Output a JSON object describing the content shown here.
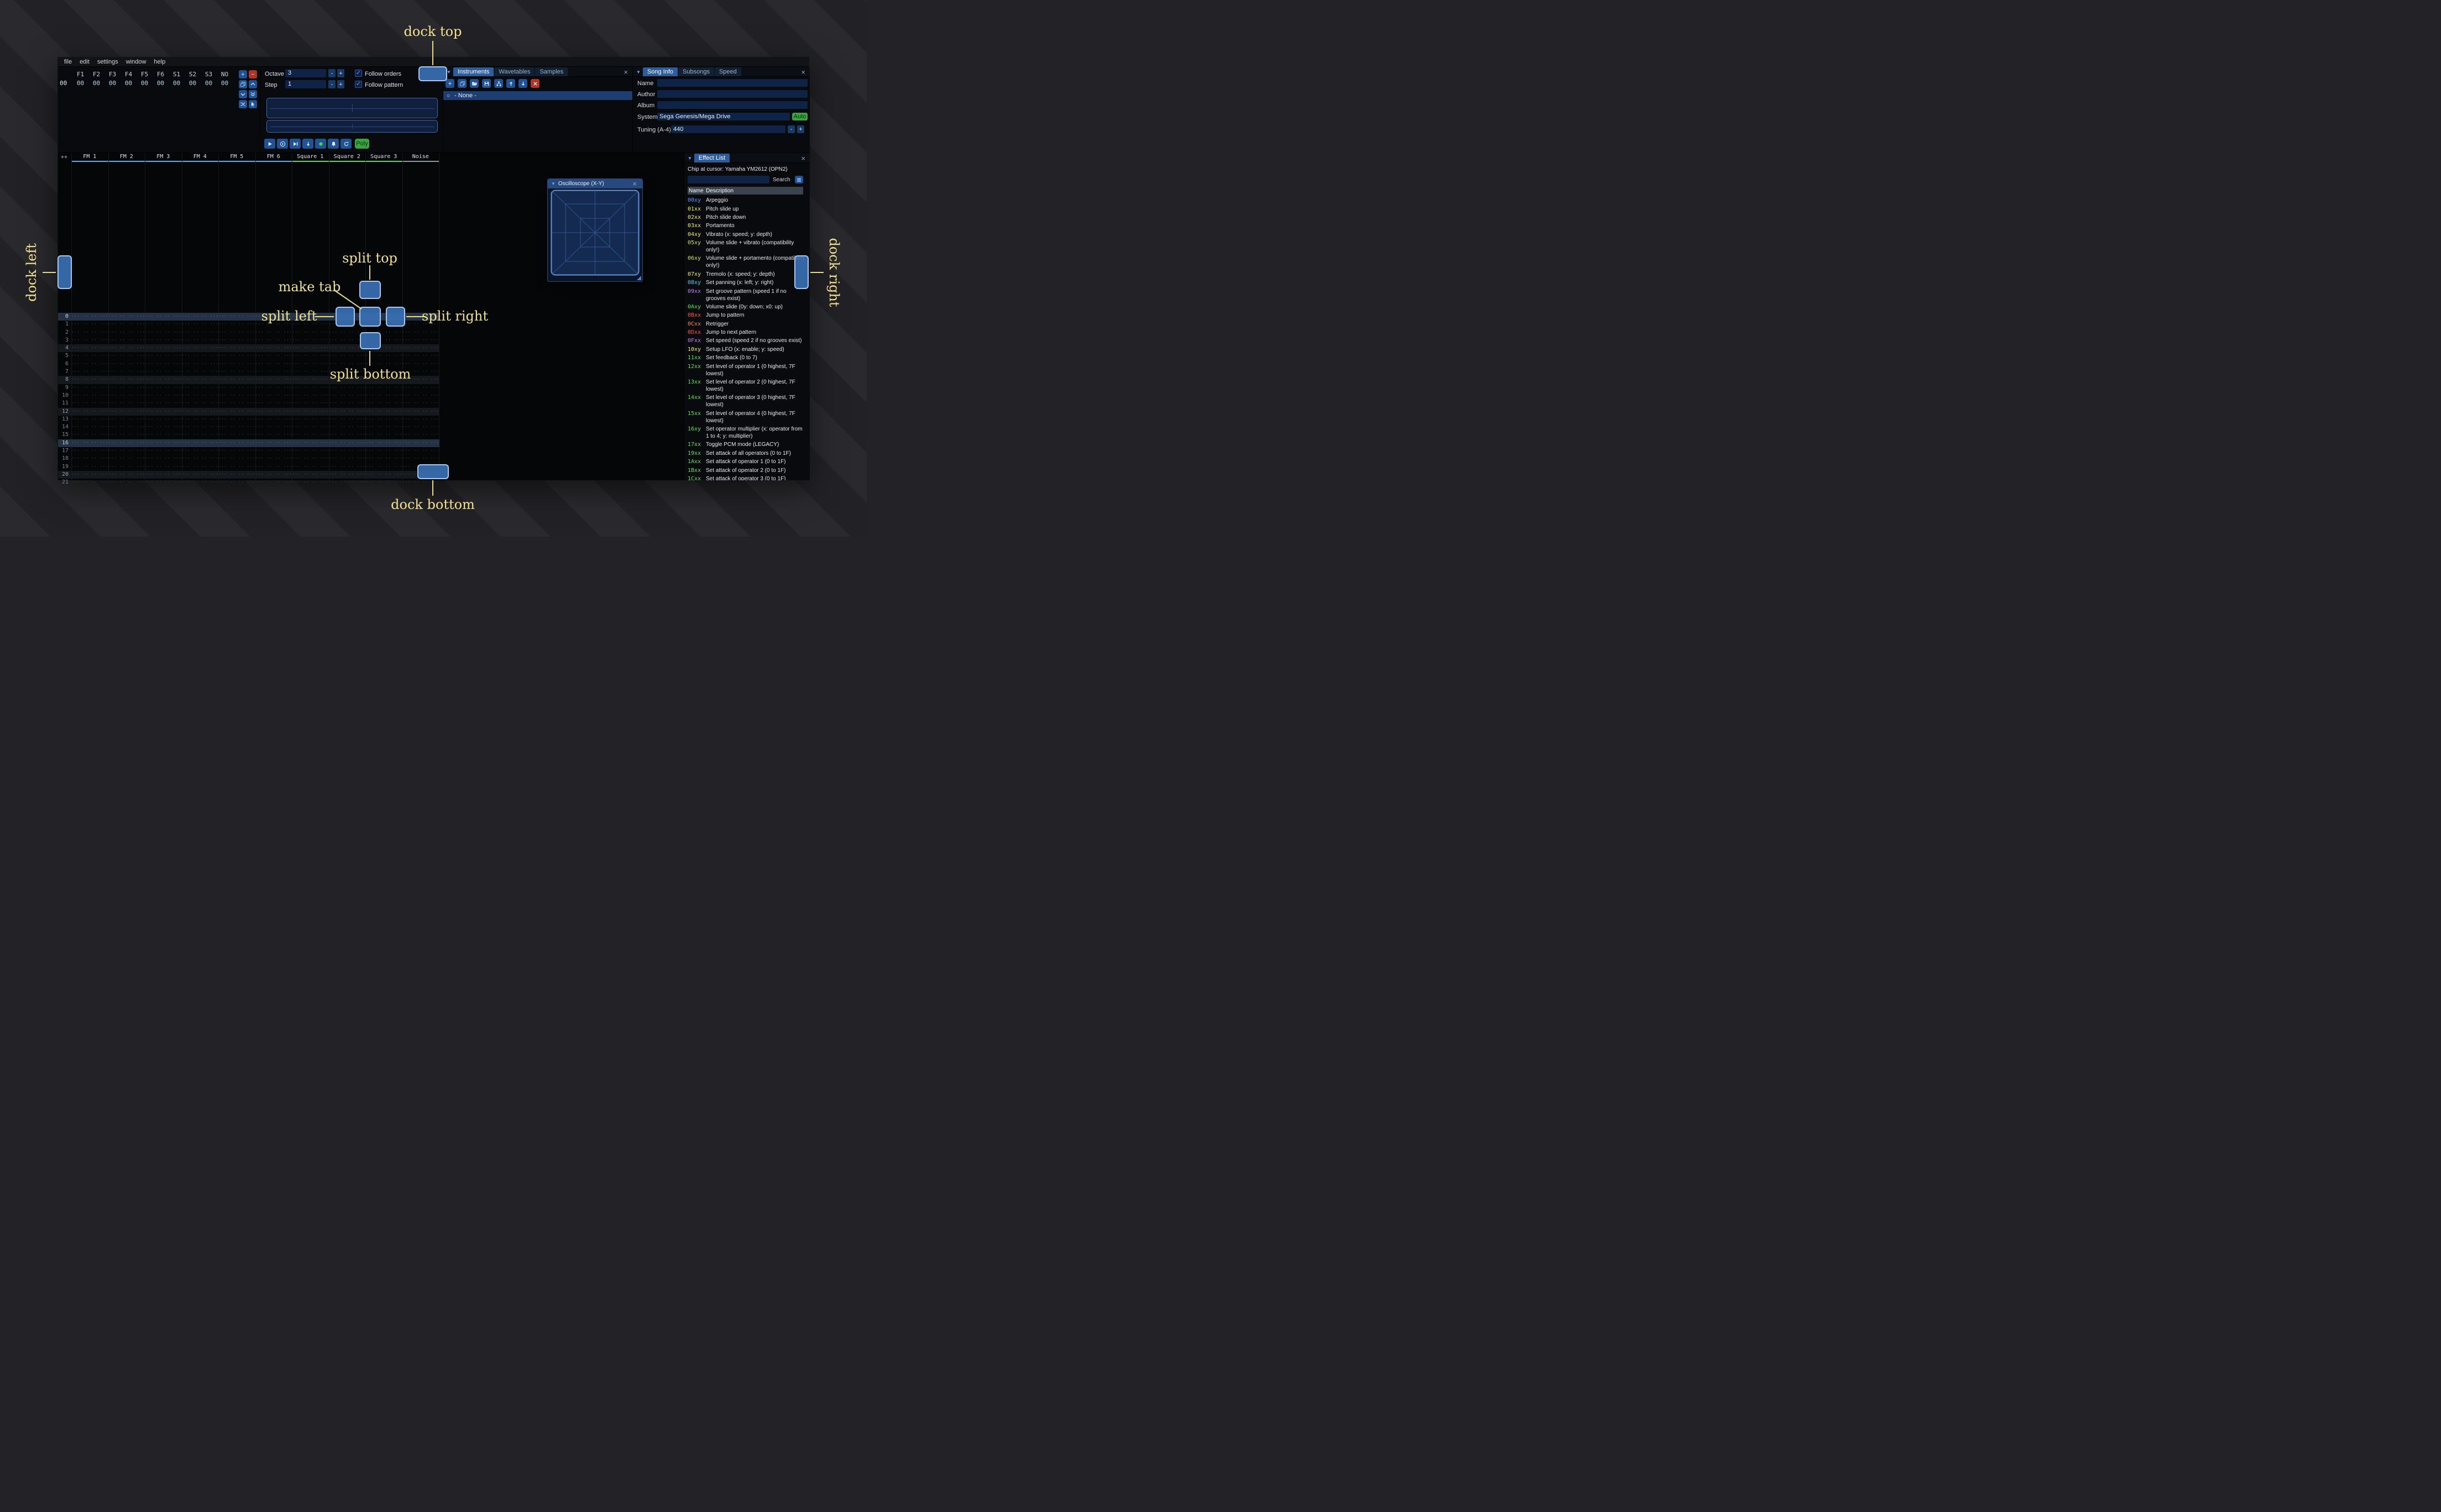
{
  "colors": {
    "accent": "#2d5d9d",
    "dock_fill": "#3a70b4",
    "annotation": "#f2e18f"
  },
  "icons": {
    "close": "×",
    "collapse": "▼",
    "radio": "○",
    "check": "✓",
    "minus": "-",
    "plus": "+"
  },
  "annotations": {
    "dock_top": "dock top",
    "dock_bottom": "dock bottom",
    "dock_left": "dock left",
    "dock_right": "dock right",
    "split_top": "split top",
    "split_bottom": "split bottom",
    "split_left": "split left",
    "split_right": "split right",
    "make_tab": "make tab"
  },
  "menu": {
    "items": [
      "file",
      "edit",
      "settings",
      "window",
      "help"
    ]
  },
  "orders": {
    "headers": [
      "F1",
      "F2",
      "F3",
      "F4",
      "F5",
      "F6",
      "S1",
      "S2",
      "S3",
      "NO"
    ],
    "row_label": "00",
    "row_values": [
      "00",
      "00",
      "00",
      "00",
      "00",
      "00",
      "00",
      "00",
      "00",
      "00"
    ],
    "buttons": [
      {
        "icon": "plus-sym",
        "name": "add-order"
      },
      {
        "icon": "minus-sym",
        "name": "remove-order",
        "red": true
      },
      {
        "icon": "duplicate",
        "name": "duplicate-order"
      },
      {
        "icon": "chevron-up",
        "name": "move-order-up"
      },
      {
        "icon": "chevron-down",
        "name": "move-order-down"
      },
      {
        "icon": "double-down",
        "name": "duplicate-order-to-end"
      },
      {
        "icon": "shuffle",
        "name": "order-change-mode"
      },
      {
        "icon": "pointer",
        "name": "order-edit-mode"
      }
    ]
  },
  "transport": {
    "octave_label": "Octave",
    "octave_value": "3",
    "step_label": "Step",
    "step_value": "1",
    "follow_orders_label": "Follow orders",
    "follow_pattern_label": "Follow pattern",
    "poly_label": "Poly",
    "buttons": [
      {
        "icon": "play",
        "name": "play"
      },
      {
        "icon": "play-circle",
        "name": "play-from-start"
      },
      {
        "icon": "play-once",
        "name": "play-pattern"
      },
      {
        "icon": "arrow-down",
        "name": "step-one-row"
      },
      {
        "icon": "record",
        "name": "record"
      },
      {
        "icon": "bell",
        "name": "metronome"
      },
      {
        "icon": "repeat",
        "name": "repeat-pattern"
      }
    ]
  },
  "instruments": {
    "tabs": [
      {
        "label": "Instruments",
        "active": true
      },
      {
        "label": "Wavetables",
        "active": false
      },
      {
        "label": "Samples",
        "active": false
      }
    ],
    "toolbar": [
      {
        "icon": "plus-sym",
        "name": "add-instrument"
      },
      {
        "icon": "duplicate",
        "name": "duplicate-instrument"
      },
      {
        "icon": "folder-open",
        "name": "open-instrument"
      },
      {
        "icon": "save",
        "name": "save-instrument"
      },
      {
        "icon": "tree",
        "name": "instrument-folders-toggle"
      },
      {
        "icon": "arrow-up",
        "name": "move-instrument-up"
      },
      {
        "icon": "arrow-down",
        "name": "move-instrument-down"
      },
      {
        "icon": "delete",
        "name": "delete-instrument",
        "red": true
      }
    ],
    "items": [
      {
        "label": "- None -",
        "selected": true
      }
    ]
  },
  "song_info": {
    "tabs": [
      {
        "label": "Song Info",
        "active": true
      },
      {
        "label": "Subsongs",
        "active": false
      },
      {
        "label": "Speed",
        "active": false
      }
    ],
    "name_label": "Name",
    "name_value": "",
    "author_label": "Author",
    "author_value": "",
    "album_label": "Album",
    "album_value": "",
    "system_label": "System",
    "system_value": "Sega Genesis/Mega Drive",
    "auto_label": "Auto",
    "tuning_label": "Tuning (A-4)",
    "tuning_value": "440"
  },
  "pattern": {
    "corner_label": "++",
    "channels": [
      {
        "name": "FM 1",
        "type": "fm"
      },
      {
        "name": "FM 2",
        "type": "fm"
      },
      {
        "name": "FM 3",
        "type": "fm"
      },
      {
        "name": "FM 4",
        "type": "fm"
      },
      {
        "name": "FM 5",
        "type": "fm"
      },
      {
        "name": "FM 6",
        "type": "fm"
      },
      {
        "name": "Square 1",
        "type": "square"
      },
      {
        "name": "Square 2",
        "type": "square"
      },
      {
        "name": "Square 3",
        "type": "square"
      },
      {
        "name": "Noise",
        "type": "noise"
      }
    ],
    "channel_colors": {
      "fm": "#3fb6f0",
      "square": "#3fe06e",
      "noise": "#9097a0"
    },
    "row_count": 22,
    "first_row_number": 0,
    "empty_cell": "··· ·· ·· ···"
  },
  "oscilloscope_xy": {
    "title": "Oscilloscope (X-Y)"
  },
  "effect_list": {
    "title": "Effect List",
    "chip_line": "Chip at cursor: Yamaha YM2612 (OPN2)",
    "search_label": "Search",
    "name_column": "Name",
    "description_column": "Description",
    "effects": [
      {
        "code": "00xy",
        "color": "#4f9fff",
        "desc": "Arpeggio"
      },
      {
        "code": "01xx",
        "color": "#f2f24f",
        "desc": "Pitch slide up"
      },
      {
        "code": "02xx",
        "color": "#f2f24f",
        "desc": "Pitch slide down"
      },
      {
        "code": "03xx",
        "color": "#f2f24f",
        "desc": "Portamento"
      },
      {
        "code": "04xy",
        "color": "#f2f24f",
        "desc": "Vibrato (x: speed; y: depth)"
      },
      {
        "code": "05xy",
        "color": "#c8e455",
        "desc": "Volume slide + vibrato (compatibility only!)"
      },
      {
        "code": "06xy",
        "color": "#c8e455",
        "desc": "Volume slide + portamento (compatibility only!)"
      },
      {
        "code": "07xy",
        "color": "#f2f24f",
        "desc": "Tremolo (x: speed; y: depth)"
      },
      {
        "code": "08xy",
        "color": "#40d4e0",
        "desc": "Set panning (x: left; y: right)"
      },
      {
        "code": "09xx",
        "color": "#c77dff",
        "desc": "Set groove pattern (speed 1 if no grooves exist)"
      },
      {
        "code": "0Axy",
        "color": "#58e65c",
        "desc": "Volume slide (0y: down; x0: up)"
      },
      {
        "code": "0Bxx",
        "color": "#ff5547",
        "desc": "Jump to pattern"
      },
      {
        "code": "0Cxx",
        "color": "#ff8547",
        "desc": "Retrigger"
      },
      {
        "code": "0Dxx",
        "color": "#ff5547",
        "desc": "Jump to next pattern"
      },
      {
        "code": "0Fxx",
        "color": "#c77dff",
        "desc": "Set speed (speed 2 if no grooves exist)"
      },
      {
        "code": "10xy",
        "color": "#f2f24f",
        "desc": "Setup LFO (x: enable; y: speed)"
      },
      {
        "code": "11xx",
        "color": "#58e65c",
        "desc": "Set feedback (0 to 7)"
      },
      {
        "code": "12xx",
        "color": "#58e65c",
        "desc": "Set level of operator 1 (0 highest, 7F lowest)"
      },
      {
        "code": "13xx",
        "color": "#58e65c",
        "desc": "Set level of operator 2 (0 highest, 7F lowest)"
      },
      {
        "code": "14xx",
        "color": "#58e65c",
        "desc": "Set level of operator 3 (0 highest, 7F lowest)"
      },
      {
        "code": "15xx",
        "color": "#58e65c",
        "desc": "Set level of operator 4 (0 highest, 7F lowest)"
      },
      {
        "code": "16xy",
        "color": "#58e65c",
        "desc": "Set operator multiplier (x: operator from 1 to 4; y: multiplier)"
      },
      {
        "code": "17xx",
        "color": "#58e65c",
        "desc": "Toggle PCM mode (LEGACY)"
      },
      {
        "code": "19xx",
        "color": "#58e65c",
        "desc": "Set attack of all operators (0 to 1F)"
      },
      {
        "code": "1Axx",
        "color": "#58e65c",
        "desc": "Set attack of operator 1 (0 to 1F)"
      },
      {
        "code": "1Bxx",
        "color": "#58e65c",
        "desc": "Set attack of operator 2 (0 to 1F)"
      },
      {
        "code": "1Cxx",
        "color": "#58e65c",
        "desc": "Set attack of operator 3 (0 to 1F)"
      }
    ]
  }
}
